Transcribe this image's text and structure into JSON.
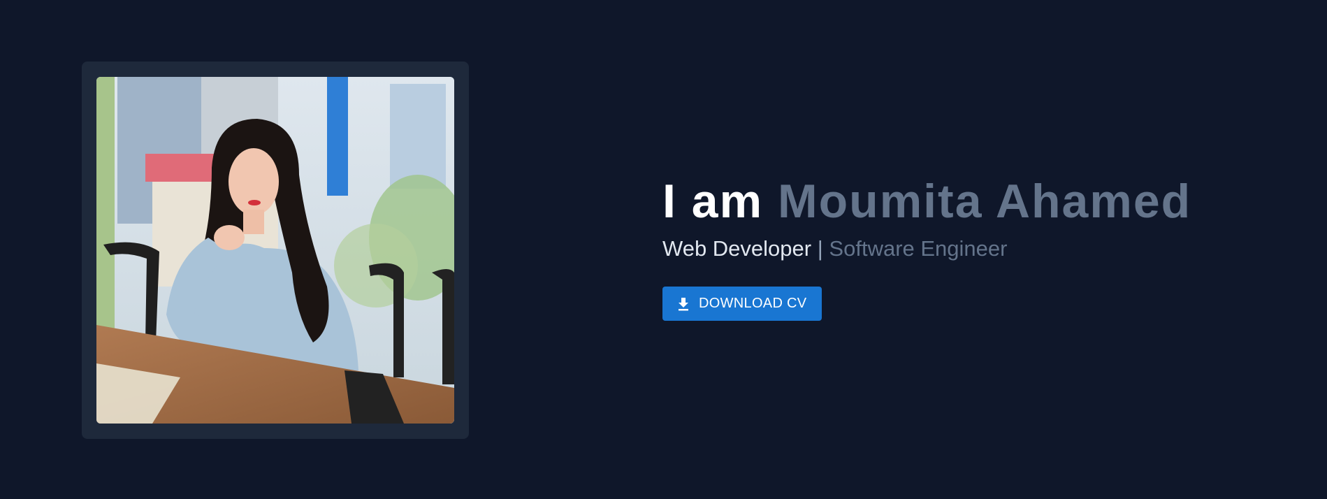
{
  "hero": {
    "photo_alt": "Moumita Ahamed",
    "headline_prefix": "I am",
    "headline_name": "Moumita Ahamed",
    "roles": {
      "primary": "Web Developer",
      "separator": "|",
      "secondary": "Software Engineer"
    },
    "download_button": {
      "label": "DOWNLOAD CV",
      "icon": "download-icon"
    }
  },
  "colors": {
    "background": "#0f172a",
    "card": "#1e293b",
    "accent": "#1976d2",
    "name_gray": "#64748b"
  }
}
